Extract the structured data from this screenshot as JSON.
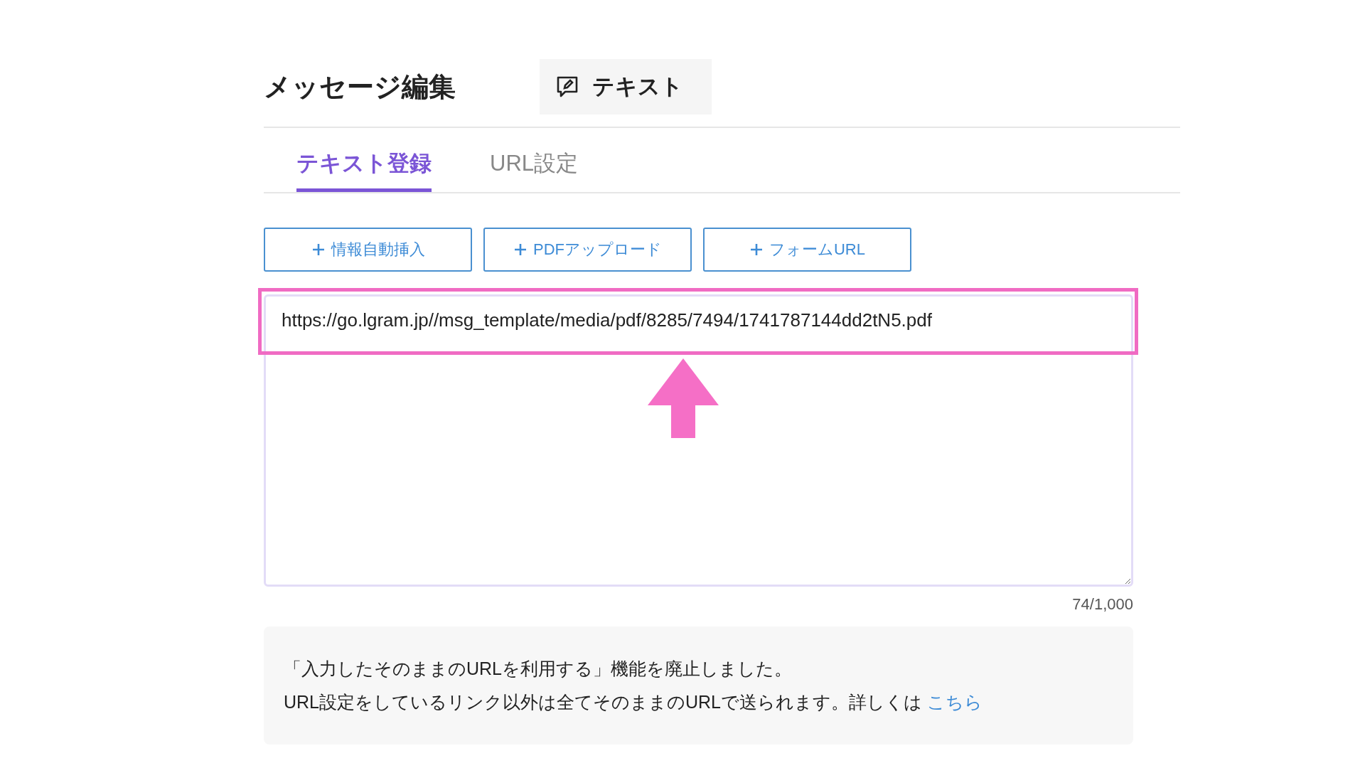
{
  "header": {
    "title": "メッセージ編集",
    "type_badge": "テキスト"
  },
  "tabs": [
    {
      "label": "テキスト登録",
      "selected": true
    },
    {
      "label": "URL設定",
      "selected": false
    }
  ],
  "insert_buttons": [
    {
      "label": "情報自動挿入"
    },
    {
      "label": "PDFアップロード"
    },
    {
      "label": "フォームURL"
    }
  ],
  "message_field": {
    "value": "https://go.lgram.jp//msg_template/media/pdf/8285/7494/1741787144dd2tN5.pdf",
    "counter": "74/1,000"
  },
  "notice": {
    "lines": [
      "「入力したそのままのURLを利用する」機能を廃止しました。",
      "URL設定をしているリンク以外は全てそのままのURLで送られます。詳しくは "
    ],
    "link": "こちら"
  }
}
